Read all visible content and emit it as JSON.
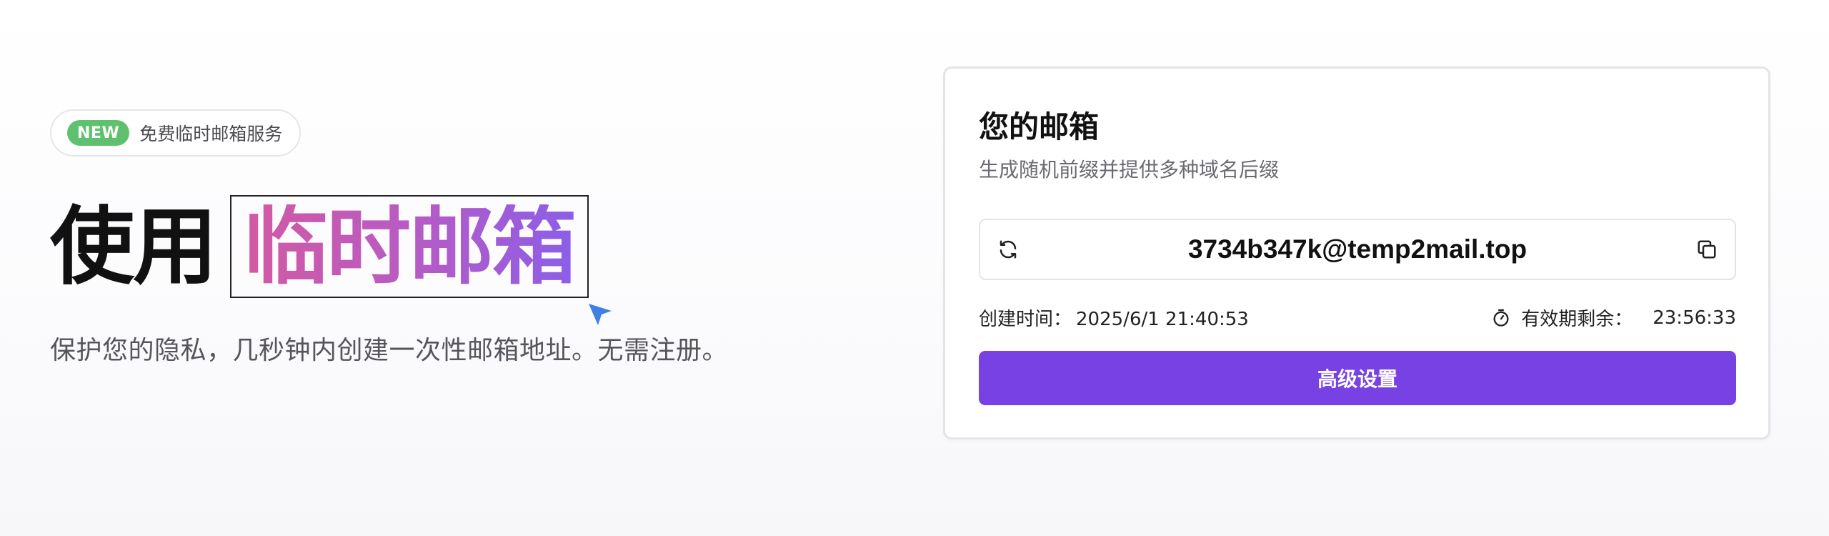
{
  "hero": {
    "badge_tag": "NEW",
    "badge_text": "免费临时邮箱服务",
    "title_plain": "使用",
    "title_highlight": "临时邮箱",
    "subtitle": "保护您的隐私，几秒钟内创建一次性邮箱地址。无需注册。"
  },
  "card": {
    "title": "您的邮箱",
    "description": "生成随机前缀并提供多种域名后缀",
    "email": "3734b347k@temp2mail.top",
    "created_label": "创建时间：",
    "created_value": "2025/6/1 21:40:53",
    "remaining_label": "有效期剩余：",
    "remaining_value": "23:56:33",
    "advanced_button": "高级设置"
  },
  "icons": {
    "refresh": "refresh-icon",
    "copy": "copy-icon",
    "timer": "timer-icon",
    "cursor": "cursor-arrow-icon"
  },
  "colors": {
    "accent": "#7841e3",
    "badge_green": "#5fc16f",
    "gradient_start": "#d35aa3",
    "gradient_end": "#8b5ee8",
    "cursor_blue": "#3f7fe6"
  }
}
